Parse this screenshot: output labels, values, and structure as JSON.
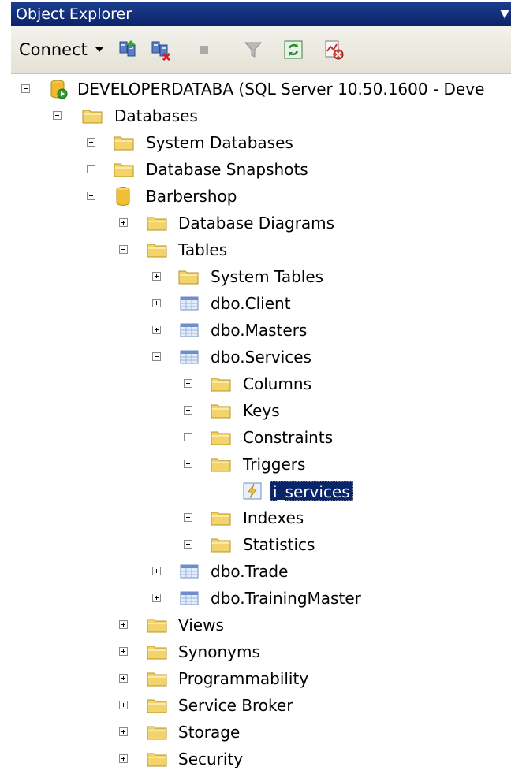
{
  "title": "Object Explorer",
  "toolbar": {
    "connect_label": "Connect",
    "icons": [
      "register-server-icon",
      "new-query-icon",
      "disconnect-icon",
      "stop-icon",
      "filter-icon",
      "refresh-icon",
      "activity-monitor-icon"
    ]
  },
  "tree": {
    "server": "DEVELOPERDATABA (SQL Server 10.50.1600 - Deve",
    "databases": "Databases",
    "system_databases": "System Databases",
    "database_snapshots": "Database Snapshots",
    "barbershop": "Barbershop",
    "database_diagrams": "Database Diagrams",
    "tables": "Tables",
    "system_tables": "System Tables",
    "client": "dbo.Client",
    "masters": "dbo.Masters",
    "services": "dbo.Services",
    "columns": "Columns",
    "keys": "Keys",
    "constraints": "Constraints",
    "triggers": "Triggers",
    "trigger_i_services": "i_services",
    "indexes": "Indexes",
    "statistics": "Statistics",
    "trade": "dbo.Trade",
    "training_master": "dbo.TrainingMaster",
    "views": "Views",
    "synonyms": "Synonyms",
    "programmability": "Programmability",
    "service_broker": "Service Broker",
    "storage": "Storage",
    "security": "Security"
  },
  "colors": {
    "title_bar": "#0a246a",
    "selection": "#0a246a",
    "folder": "#f3d36b",
    "table_icon": "#6d8ec7"
  }
}
